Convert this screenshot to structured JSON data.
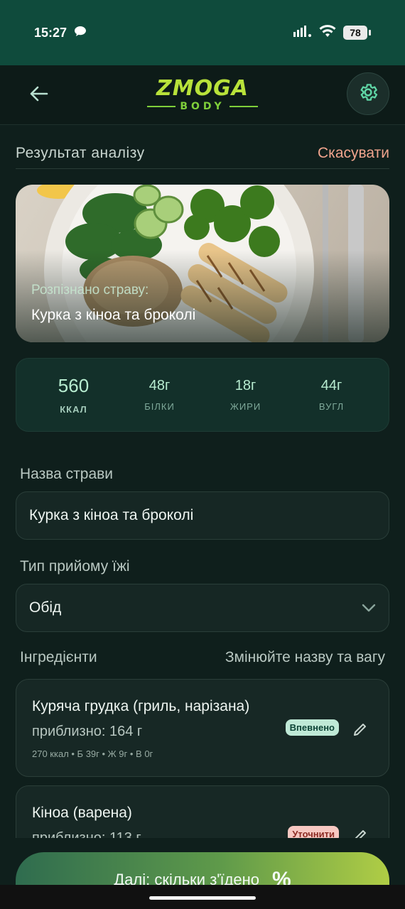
{
  "status_bar": {
    "time": "15:27",
    "battery": "78"
  },
  "header": {
    "logo_main": "ZMOGA",
    "logo_sub": "BODY"
  },
  "result": {
    "title": "Результат аналізу",
    "cancel": "Скасувати"
  },
  "hero": {
    "label": "Розпізнано страву:",
    "dish": "Курка з кіноа та броколі"
  },
  "macros": [
    {
      "value": "560",
      "label": "ККАЛ"
    },
    {
      "value": "48г",
      "label": "БІЛКИ"
    },
    {
      "value": "18г",
      "label": "ЖИРИ"
    },
    {
      "value": "44г",
      "label": "ВУГЛ"
    }
  ],
  "form": {
    "name_label": "Назва страви",
    "name_value": "Курка з кіноа та броколі",
    "meal_label": "Тип прийому їжі",
    "meal_value": "Обід"
  },
  "ingredients": {
    "title": "Інгредієнти",
    "hint": "Змінюйте назву та вагу",
    "items": [
      {
        "name": "Куряча грудка (гриль, нарізана)",
        "approx": "приблизно: 164 г",
        "meta": "270 ккал • Б 39г • Ж 9г • В 0г",
        "badge": "Впевнено"
      },
      {
        "name": "Кіноа (варена)",
        "approx": "приблизно: 113 г",
        "meta": "",
        "badge": "Уточнити"
      }
    ]
  },
  "next_button": {
    "label": "Далі: скільки з'їдено",
    "icon": "%"
  }
}
